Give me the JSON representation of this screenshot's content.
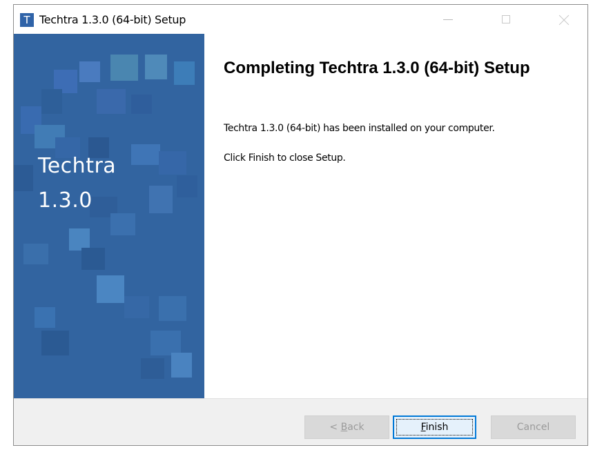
{
  "window": {
    "title": "Techtra 1.3.0 (64-bit) Setup",
    "app_icon_letter": "T",
    "app_icon": "techtra-app-icon",
    "controls": {
      "minimize_icon": "minimize-icon",
      "maximize_icon": "maximize-icon",
      "close_icon": "close-icon"
    }
  },
  "side_panel": {
    "brand_line_1": "Techtra",
    "brand_line_2": "1.3.0",
    "background_color": "#3264a0"
  },
  "content": {
    "heading": "Completing Techtra 1.3.0 (64-bit) Setup",
    "message_installed": "Techtra 1.3.0 (64-bit) has been installed on your computer.",
    "message_close": "Click Finish to close Setup."
  },
  "footer": {
    "back_button": {
      "prefix": "< ",
      "accel": "B",
      "rest": "ack",
      "enabled": false
    },
    "finish_button": {
      "accel": "F",
      "rest": "inish",
      "enabled": true,
      "focused": true
    },
    "cancel_button": {
      "label": "Cancel",
      "enabled": false
    }
  },
  "colors": {
    "accent": "#0078d7",
    "panel": "#3264a0",
    "disabled_text": "#9a9a9a"
  }
}
